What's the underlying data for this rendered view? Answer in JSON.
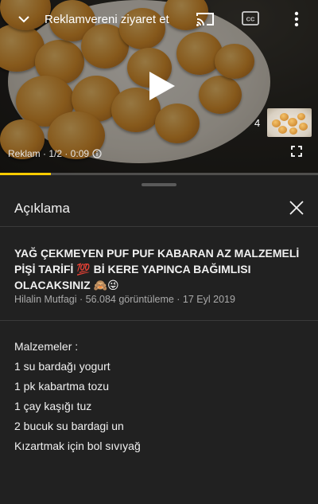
{
  "player": {
    "ad_link_label": "Reklamvereni ziyaret et",
    "playlist_count": "4",
    "ad_status": "Reklam · 1/2 · 0:09",
    "progress_fraction": 0.16,
    "progress_color": "#ffcc00",
    "icons": [
      "chevron-down-icon",
      "cast-icon",
      "captions-icon",
      "more-vert-icon",
      "play-icon",
      "info-icon",
      "fullscreen-icon"
    ]
  },
  "panel": {
    "title": "Açıklama",
    "close_icon": "close-icon"
  },
  "video": {
    "title": "YAĞ ÇEKMEYEN PUF PUF KABARAN AZ MALZEMELİ PİŞİ TARİFİ 💯 Bİ KERE YAPINCA BAĞIMLISI OLACAKSINIZ 🙈😜",
    "meta": "Hilalin Mutfagi · 56.084 görüntüleme · 17 Eyl 2019"
  },
  "description": {
    "lines": [
      "Malzemeler :",
      "1 su bardağı yogurt",
      "1 pk kabartma tozu",
      "1 çay kaşığı tuz",
      "2 bucuk su bardagi un",
      "Kızartmak için bol sıvıyağ"
    ]
  }
}
